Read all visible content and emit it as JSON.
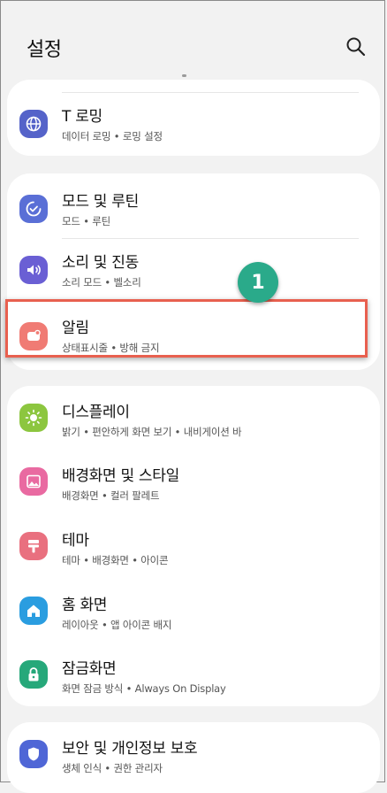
{
  "header": {
    "title": "설정"
  },
  "groups": [
    {
      "items": [
        {
          "label": "T 로밍",
          "sub": "데이터 로밍 • 로밍 설정",
          "color": "#5563c9"
        }
      ]
    },
    {
      "items": [
        {
          "label": "모드 및 루틴",
          "sub": "모드 • 루틴",
          "color": "#5a6fd6"
        },
        {
          "label": "소리 및 진동",
          "sub": "소리 모드 • 벨소리",
          "color": "#6a5fd4"
        },
        {
          "label": "알림",
          "sub": "상태표시줄 • 방해 금지",
          "color": "#f07b74"
        }
      ]
    },
    {
      "items": [
        {
          "label": "디스플레이",
          "sub": "밝기 • 편안하게 화면 보기 • 내비게이션 바",
          "color": "#8cc63f"
        },
        {
          "label": "배경화면 및 스타일",
          "sub": "배경화면 • 컬러 팔레트",
          "color": "#e96aa1"
        },
        {
          "label": "테마",
          "sub": "테마 • 배경화면 • 아이콘",
          "color": "#e9707f"
        },
        {
          "label": "홈 화면",
          "sub": "레이아웃 • 앱 아이콘 배지",
          "color": "#2a9de0"
        },
        {
          "label": "잠금화면",
          "sub": "화면 잠금 방식 • Always On Display",
          "color": "#26a87a"
        }
      ]
    },
    {
      "items": [
        {
          "label": "보안 및 개인정보 보호",
          "sub": "생체 인식 • 권한 관리자",
          "color": "#4f66d6"
        }
      ]
    }
  ],
  "annotation": {
    "step": "1"
  }
}
